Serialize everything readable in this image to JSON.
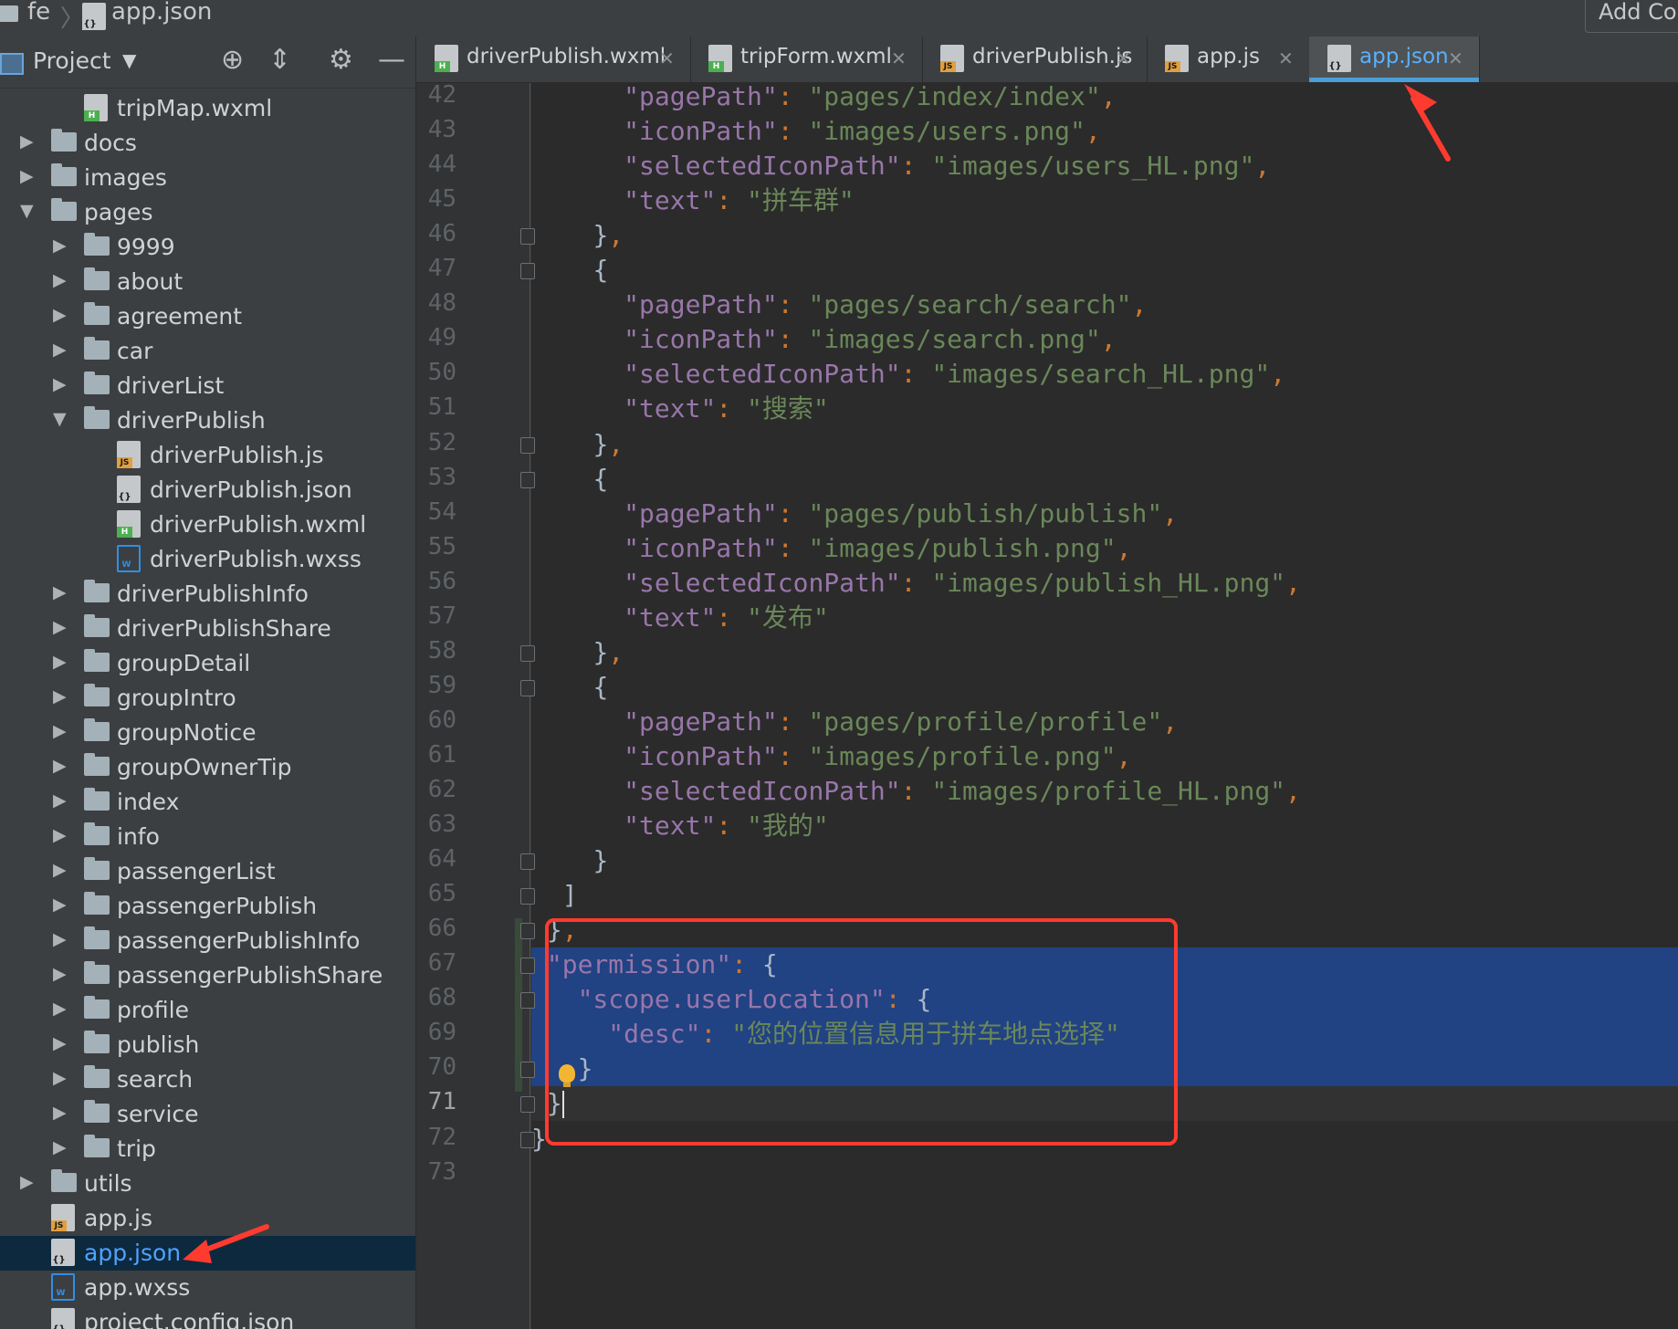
{
  "breadcrumb": {
    "root": "fe",
    "file": "app.json"
  },
  "add_config_label": "Add Con",
  "project_panel": {
    "title": "Project"
  },
  "tree": [
    {
      "label": "tripMap.wxml",
      "kind": "wx",
      "depth": 2
    },
    {
      "label": "docs",
      "kind": "folder",
      "depth": 1,
      "state": "collapsed"
    },
    {
      "label": "images",
      "kind": "folder",
      "depth": 1,
      "state": "collapsed"
    },
    {
      "label": "pages",
      "kind": "folder",
      "depth": 1,
      "state": "expanded"
    },
    {
      "label": "9999",
      "kind": "folder",
      "depth": 2,
      "state": "collapsed"
    },
    {
      "label": "about",
      "kind": "folder",
      "depth": 2,
      "state": "collapsed"
    },
    {
      "label": "agreement",
      "kind": "folder",
      "depth": 2,
      "state": "collapsed"
    },
    {
      "label": "car",
      "kind": "folder",
      "depth": 2,
      "state": "collapsed"
    },
    {
      "label": "driverList",
      "kind": "folder",
      "depth": 2,
      "state": "collapsed"
    },
    {
      "label": "driverPublish",
      "kind": "folder",
      "depth": 2,
      "state": "expanded"
    },
    {
      "label": "driverPublish.js",
      "kind": "js",
      "depth": 3
    },
    {
      "label": "driverPublish.json",
      "kind": "json",
      "depth": 3
    },
    {
      "label": "driverPublish.wxml",
      "kind": "wx",
      "depth": 3
    },
    {
      "label": "driverPublish.wxss",
      "kind": "css",
      "depth": 3
    },
    {
      "label": "driverPublishInfo",
      "kind": "folder",
      "depth": 2,
      "state": "collapsed"
    },
    {
      "label": "driverPublishShare",
      "kind": "folder",
      "depth": 2,
      "state": "collapsed"
    },
    {
      "label": "groupDetail",
      "kind": "folder",
      "depth": 2,
      "state": "collapsed"
    },
    {
      "label": "groupIntro",
      "kind": "folder",
      "depth": 2,
      "state": "collapsed"
    },
    {
      "label": "groupNotice",
      "kind": "folder",
      "depth": 2,
      "state": "collapsed"
    },
    {
      "label": "groupOwnerTip",
      "kind": "folder",
      "depth": 2,
      "state": "collapsed"
    },
    {
      "label": "index",
      "kind": "folder",
      "depth": 2,
      "state": "collapsed"
    },
    {
      "label": "info",
      "kind": "folder",
      "depth": 2,
      "state": "collapsed"
    },
    {
      "label": "passengerList",
      "kind": "folder",
      "depth": 2,
      "state": "collapsed"
    },
    {
      "label": "passengerPublish",
      "kind": "folder",
      "depth": 2,
      "state": "collapsed"
    },
    {
      "label": "passengerPublishInfo",
      "kind": "folder",
      "depth": 2,
      "state": "collapsed"
    },
    {
      "label": "passengerPublishShare",
      "kind": "folder",
      "depth": 2,
      "state": "collapsed"
    },
    {
      "label": "profile",
      "kind": "folder",
      "depth": 2,
      "state": "collapsed"
    },
    {
      "label": "publish",
      "kind": "folder",
      "depth": 2,
      "state": "collapsed"
    },
    {
      "label": "search",
      "kind": "folder",
      "depth": 2,
      "state": "collapsed"
    },
    {
      "label": "service",
      "kind": "folder",
      "depth": 2,
      "state": "collapsed"
    },
    {
      "label": "trip",
      "kind": "folder",
      "depth": 2,
      "state": "collapsed"
    },
    {
      "label": "utils",
      "kind": "folder",
      "depth": 1,
      "state": "collapsed"
    },
    {
      "label": "app.js",
      "kind": "js",
      "depth": 1
    },
    {
      "label": "app.json",
      "kind": "json",
      "depth": 1,
      "selected": true
    },
    {
      "label": "app.wxss",
      "kind": "css",
      "depth": 1
    },
    {
      "label": "project.config.json",
      "kind": "json",
      "depth": 1
    }
  ],
  "tabs": [
    {
      "label": "driverPublish.wxml",
      "kind": "wx"
    },
    {
      "label": "tripForm.wxml",
      "kind": "wx"
    },
    {
      "label": "driverPublish.js",
      "kind": "js"
    },
    {
      "label": "app.js",
      "kind": "js"
    },
    {
      "label": "app.json",
      "kind": "json",
      "active": true
    }
  ],
  "editor": {
    "first_line": 42,
    "current_line": 71,
    "lines": [
      "      \"pagePath\": \"pages/index/index\",",
      "      \"iconPath\": \"images/users.png\",",
      "      \"selectedIconPath\": \"images/users_HL.png\",",
      "      \"text\": \"拼车群\"",
      "    },",
      "    {",
      "      \"pagePath\": \"pages/search/search\",",
      "      \"iconPath\": \"images/search.png\",",
      "      \"selectedIconPath\": \"images/search_HL.png\",",
      "      \"text\": \"搜索\"",
      "    },",
      "    {",
      "      \"pagePath\": \"pages/publish/publish\",",
      "      \"iconPath\": \"images/publish.png\",",
      "      \"selectedIconPath\": \"images/publish_HL.png\",",
      "      \"text\": \"发布\"",
      "    },",
      "    {",
      "      \"pagePath\": \"pages/profile/profile\",",
      "      \"iconPath\": \"images/profile.png\",",
      "      \"selectedIconPath\": \"images/profile_HL.png\",",
      "      \"text\": \"我的\"",
      "    }",
      "  ]",
      " },",
      " \"permission\": {",
      "   \"scope.userLocation\": {",
      "     \"desc\": \"您的位置信息用于拼车地点选择\"",
      "   }",
      " }",
      "}",
      ""
    ]
  },
  "colors": {
    "selection": "#214283",
    "annotation": "#ff3b30",
    "active_tab_accent": "#4a9fd8"
  }
}
